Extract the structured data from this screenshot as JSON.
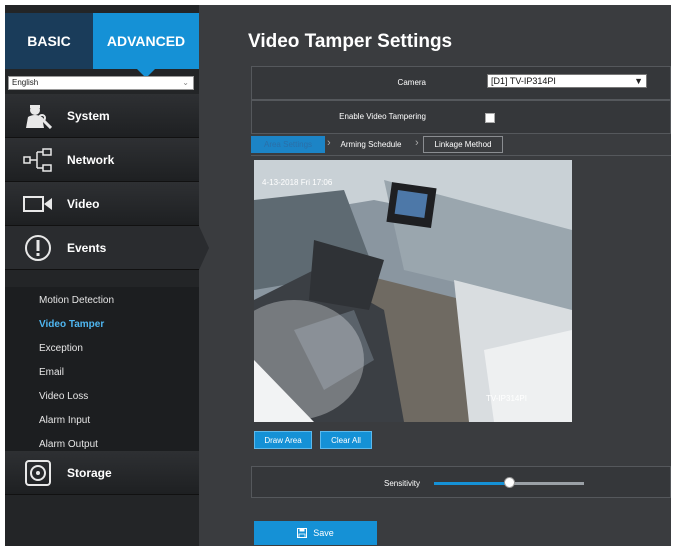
{
  "modes": {
    "basic": "BASIC",
    "advanced": "ADVANCED"
  },
  "language": {
    "selected": "English"
  },
  "nav": {
    "system": "System",
    "network": "Network",
    "video": "Video",
    "events": "Events",
    "storage": "Storage"
  },
  "events_submenu": [
    "Motion Detection",
    "Video Tamper",
    "Exception",
    "Email",
    "Video Loss",
    "Alarm Input",
    "Alarm Output"
  ],
  "page_title": "Video Tamper Settings",
  "form": {
    "camera_label": "Camera",
    "camera_value": "[D1] TV-IP314PI",
    "enable_label": "Enable Video Tampering",
    "enable_checked": false
  },
  "subtabs": {
    "area": "Area Settings",
    "arming": "Arming Schedule",
    "linkage": "Linkage Method"
  },
  "video_osd": {
    "timestamp": "4-13-2018 Fri 17:06",
    "camera_name": "TV-IP314PI"
  },
  "buttons": {
    "draw_area": "Draw Area",
    "clear_all": "Clear All",
    "save": "Save"
  },
  "sensitivity": {
    "label": "Sensitivity",
    "value_fraction": 0.5
  },
  "colors": {
    "accent": "#1591d6",
    "active_submenu": "#4fb6f0",
    "sidebar_bg": "#232527",
    "content_bg": "#3a3c3f"
  }
}
